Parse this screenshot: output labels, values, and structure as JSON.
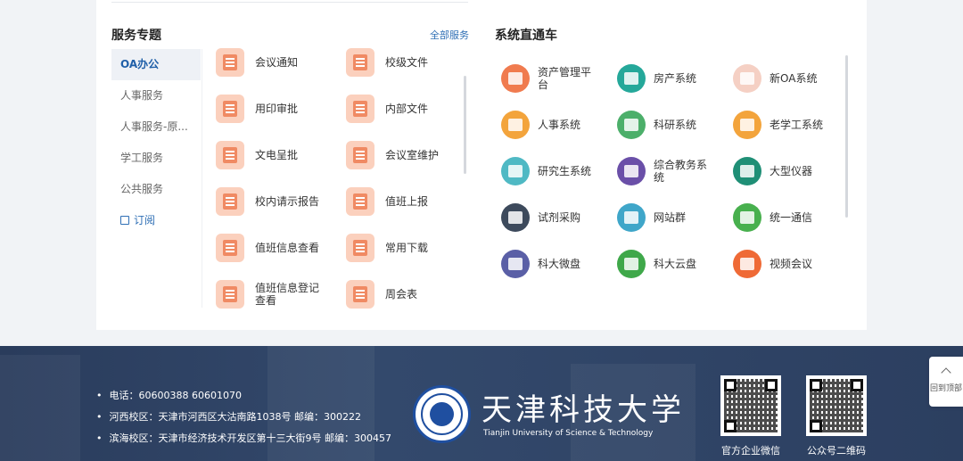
{
  "services": {
    "title": "服务专题",
    "more_label": "全部服务",
    "tabs": [
      {
        "label": "OA办公",
        "active": true
      },
      {
        "label": "人事服务"
      },
      {
        "label": "人事服务-原..."
      },
      {
        "label": "学工服务"
      },
      {
        "label": "公共服务"
      },
      {
        "label": "订阅",
        "icon": "subscribe-icon"
      }
    ],
    "items": [
      {
        "label": "会议通知",
        "icon": "bell-icon"
      },
      {
        "label": "校级文件",
        "icon": "folder-icon"
      },
      {
        "label": "用印审批",
        "icon": "stamp-icon"
      },
      {
        "label": "内部文件",
        "icon": "folder-icon"
      },
      {
        "label": "文电呈批",
        "icon": "document-download-icon"
      },
      {
        "label": "会议室维护",
        "icon": "meeting-room-icon"
      },
      {
        "label": "校内请示报告",
        "icon": "clipboard-icon"
      },
      {
        "label": "值班上报",
        "icon": "upload-icon"
      },
      {
        "label": "值班信息查看",
        "icon": "search-user-icon"
      },
      {
        "label": "常用下载",
        "icon": "download-icon"
      },
      {
        "label": "值班信息登记查看",
        "icon": "edit-user-icon"
      },
      {
        "label": "周会表",
        "icon": "table-icon"
      }
    ]
  },
  "systems": {
    "title": "系统直通车",
    "items": [
      {
        "label": "资产管理平台",
        "icon": "asset-icon",
        "color": "#f07b4f"
      },
      {
        "label": "房产系统",
        "icon": "house-icon",
        "color": "#25a89a"
      },
      {
        "label": "新OA系统",
        "icon": "oa-icon",
        "color": "#f5d0c4"
      },
      {
        "label": "人事系统",
        "icon": "personnel-icon",
        "color": "#f3a43c"
      },
      {
        "label": "科研系统",
        "icon": "research-icon",
        "color": "#4caf6a"
      },
      {
        "label": "老学工系统",
        "icon": "student-affairs-icon",
        "color": "#f3a43c"
      },
      {
        "label": "研究生系统",
        "icon": "graduate-icon",
        "color": "#4fb9c4"
      },
      {
        "label": "综合教务系统",
        "icon": "academic-icon",
        "color": "#6a4fa8"
      },
      {
        "label": "大型仪器",
        "icon": "instrument-icon",
        "color": "#1f8f76"
      },
      {
        "label": "试剂采购",
        "icon": "dropbox-icon",
        "color": "#3d4a5c"
      },
      {
        "label": "网站群",
        "icon": "website-icon",
        "color": "#3fa6c9"
      },
      {
        "label": "统一通信",
        "icon": "communication-icon",
        "color": "#48b04e"
      },
      {
        "label": "科大微盘",
        "icon": "micro-disk-icon",
        "color": "#5a5fa6"
      },
      {
        "label": "科大云盘",
        "icon": "cloud-disk-icon",
        "color": "#3fa84a"
      },
      {
        "label": "视频会议",
        "icon": "video-conference-icon",
        "color": "#ef6a36"
      }
    ]
  },
  "footer": {
    "contacts": [
      "电话：60600388 60601070",
      "河西校区：天津市河西区大沽南路1038号 邮编：300222",
      "滨海校区：天津市经济技术开发区第十三大街9号 邮编：300457"
    ],
    "school_name_cn": "天津科技大学",
    "school_name_en": "Tianjin University of Science & Technology",
    "qr_captions": [
      "官方企业微信",
      "公众号二维码"
    ],
    "back_to_top": "回到顶部"
  }
}
